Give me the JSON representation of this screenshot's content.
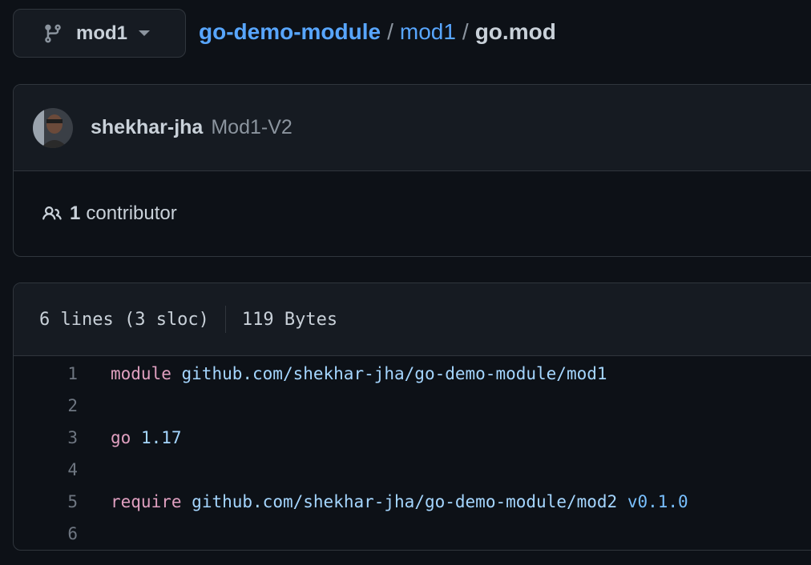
{
  "branch": {
    "name": "mod1",
    "icon": "git-branch-icon"
  },
  "breadcrumb": {
    "repo": "go-demo-module",
    "folder": "mod1",
    "separator": "/",
    "file": "go.mod"
  },
  "commit": {
    "author": "shekhar-jha",
    "message": "Mod1-V2"
  },
  "contributors": {
    "count": "1",
    "label": "contributor",
    "icon": "people-icon"
  },
  "file_info": {
    "lines": "6 lines (3 sloc)",
    "size": "119 Bytes"
  },
  "code_lines": [
    {
      "n": "1",
      "keyword": "module",
      "text": "github.com/shekhar-jha/go-demo-module/mod1",
      "version": ""
    },
    {
      "n": "2",
      "keyword": "",
      "text": "",
      "version": ""
    },
    {
      "n": "3",
      "keyword": "go",
      "text": "1.17",
      "version": ""
    },
    {
      "n": "4",
      "keyword": "",
      "text": "",
      "version": ""
    },
    {
      "n": "5",
      "keyword": "require",
      "text": "github.com/shekhar-jha/go-demo-module/mod2",
      "version": "v0.1.0"
    },
    {
      "n": "6",
      "keyword": "",
      "text": "",
      "version": ""
    }
  ],
  "colors": {
    "background": "#0d1117",
    "link": "#58a6ff",
    "keyword": "#e0a0c0",
    "string": "#a5d6ff",
    "version": "#79c0ff"
  }
}
